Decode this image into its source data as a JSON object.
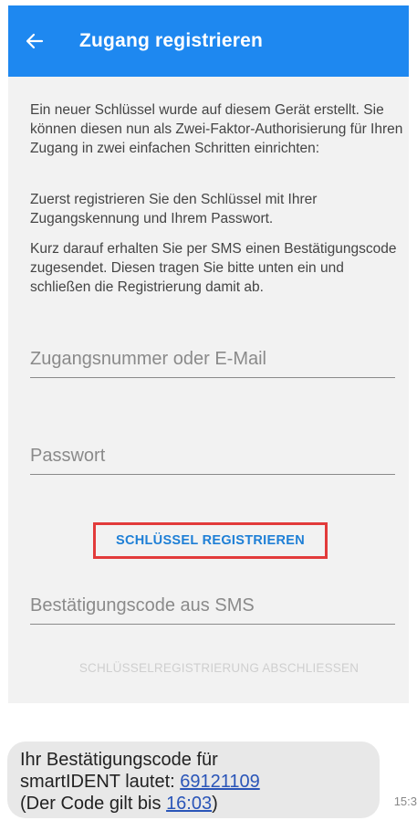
{
  "header": {
    "title": "Zugang registrieren",
    "back_icon": "arrow-left-icon"
  },
  "intro": {
    "para1": "Ein neuer Schlüssel wurde auf diesem Gerät erstellt. Sie können diesen nun als Zwei-Faktor-Authorisierung für Ihren Zugang in zwei einfachen Schritten einrichten:",
    "para2": "Zuerst registrieren Sie den Schlüssel mit Ihrer Zugangskennung und Ihrem Passwort.",
    "para3": "Kurz darauf erhalten Sie per SMS einen Bestätigungscode zugesendet. Diesen tragen Sie bitte unten ein und schließen die Registrierung damit ab."
  },
  "form": {
    "account_placeholder": "Zugangsnummer oder E-Mail",
    "account_value": "",
    "password_placeholder": "Passwort",
    "password_value": "",
    "register_button": "SCHLÜSSEL REGISTRIEREN",
    "code_placeholder": "Bestätigungscode aus SMS",
    "code_value": "",
    "finish_button": "SCHLÜSSELREGISTRIERUNG ABSCHLIESSEN"
  },
  "sms": {
    "line1": "Ihr Bestätigungscode für",
    "line2_prefix": "smartIDENT lautet: ",
    "code": "69121109",
    "line3_prefix": "(Der Code gilt bis ",
    "valid_until": "16:03",
    "line3_suffix": ")",
    "time": "15:3"
  },
  "colors": {
    "appbar": "#1e88f0",
    "highlight": "#e23b3b",
    "link": "#2a55b8"
  }
}
